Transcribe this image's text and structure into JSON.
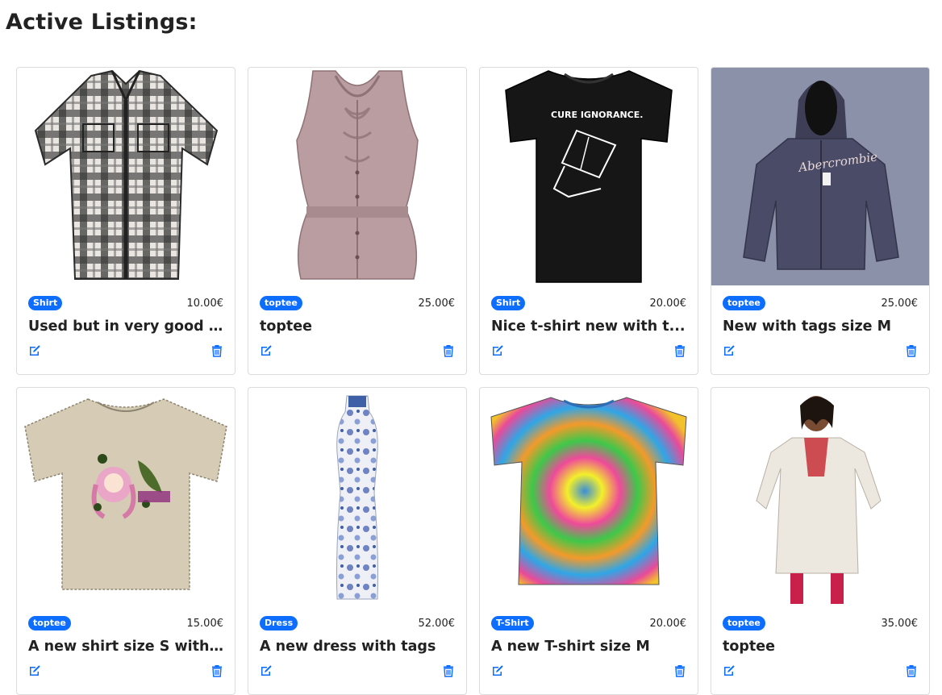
{
  "page": {
    "title": "Active Listings:"
  },
  "colors": {
    "accent": "#0d6efd",
    "card_border": "#dcdcdc"
  },
  "listings": [
    {
      "category": "Shirt",
      "price": "10.00€",
      "title": "Used but in very good c...",
      "image": "plaid-shirt",
      "bg": "#ffffff"
    },
    {
      "category": "toptee",
      "price": "25.00€",
      "title": "toptee",
      "image": "ruffle-blouse",
      "bg": "#ffffff"
    },
    {
      "category": "Shirt",
      "price": "20.00€",
      "title": "Nice t-shirt new with t...",
      "image": "black-tshirt",
      "bg": "#ffffff",
      "print_text": "CURE IGNORANCE."
    },
    {
      "category": "toptee",
      "price": "25.00€",
      "title": "New with tags size M",
      "image": "hoodie",
      "bg": "#8b91a8",
      "print_text": "Abercrombie"
    },
    {
      "category": "toptee",
      "price": "15.00€",
      "title": "A new shirt size S with...",
      "image": "anime-tshirt",
      "bg": "#ffffff"
    },
    {
      "category": "Dress",
      "price": "52.00€",
      "title": "A new dress with tags",
      "image": "floral-dress",
      "bg": "#ffffff"
    },
    {
      "category": "T-Shirt",
      "price": "20.00€",
      "title": "A new T-shirt size M",
      "image": "tiedye-tshirt",
      "bg": "#ffffff"
    },
    {
      "category": "toptee",
      "price": "35.00€",
      "title": "toptee",
      "image": "kurti-model",
      "bg": "#ffffff"
    }
  ]
}
